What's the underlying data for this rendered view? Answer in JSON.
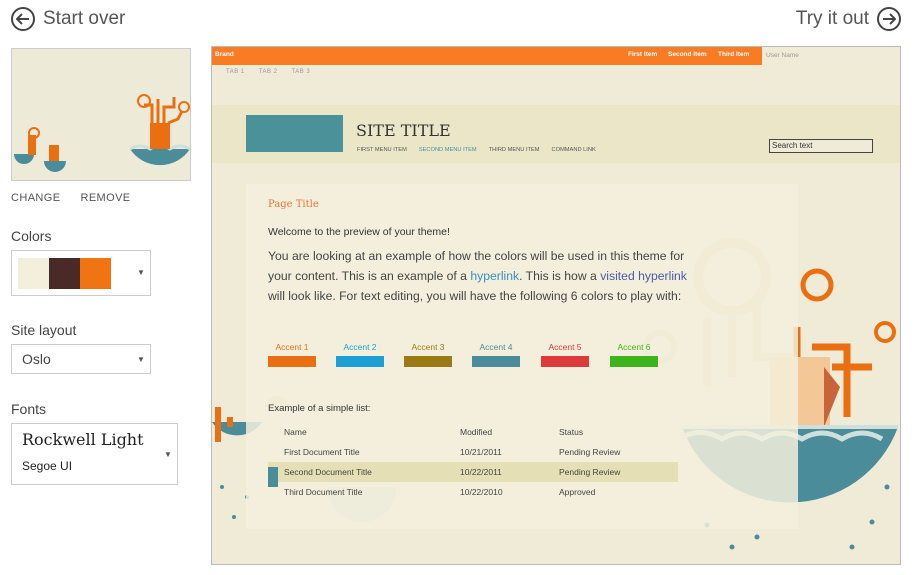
{
  "nav": {
    "start_over": "Start over",
    "try_it_out": "Try it out"
  },
  "left": {
    "change": "CHANGE",
    "remove": "REMOVE",
    "colors_label": "Colors",
    "colors": [
      "#f2f0dc",
      "#4a2a27",
      "#f07412"
    ],
    "site_layout_label": "Site layout",
    "site_layout_value": "Oslo",
    "fonts_label": "Fonts",
    "font_major": "Rockwell Light",
    "font_minor": "Segoe UI"
  },
  "preview": {
    "brand": "Brand",
    "suite_links": [
      "First Item",
      "Second Item",
      "Third Item"
    ],
    "user_name": "User Name",
    "tabs": [
      "TAB 1",
      "TAB 2",
      "TAB 3"
    ],
    "site_title": "SITE TITLE",
    "menu": [
      "FIRST MENU ITEM",
      "SECOND MENU ITEM",
      "THIRD MENU ITEM",
      "COMMAND LINK"
    ],
    "search_text": "Search text",
    "page_title": "Page Title",
    "welcome": "Welcome to the preview of your theme!",
    "body_1": "You are looking at an example of how the colors will be used in this theme for your content. This is an example of a ",
    "hyperlink": "hyperlink",
    "body_2": ". This is how a ",
    "visited_hyperlink": "visited hyperlink",
    "body_3": " will look like. For text editing, you will have the following 6 colors to play with:",
    "accents": [
      {
        "label": "Accent 1",
        "color": "#ea6f10"
      },
      {
        "label": "Accent 2",
        "color": "#1a9fd6"
      },
      {
        "label": "Accent 3",
        "color": "#9c7a13"
      },
      {
        "label": "Accent 4",
        "color": "#4a8c99"
      },
      {
        "label": "Accent 5",
        "color": "#dd3a3a"
      },
      {
        "label": "Accent 6",
        "color": "#3db41b"
      }
    ],
    "list_title": "Example of a simple list:",
    "list_headers": [
      "Name",
      "Modified",
      "Status"
    ],
    "list_rows": [
      [
        "First Document Title",
        "10/21/2011",
        "Pending Review"
      ],
      [
        "Second Document Title",
        "10/22/2011",
        "Pending Review"
      ],
      [
        "Third Document Title",
        "10/22/2010",
        "Approved"
      ]
    ]
  }
}
